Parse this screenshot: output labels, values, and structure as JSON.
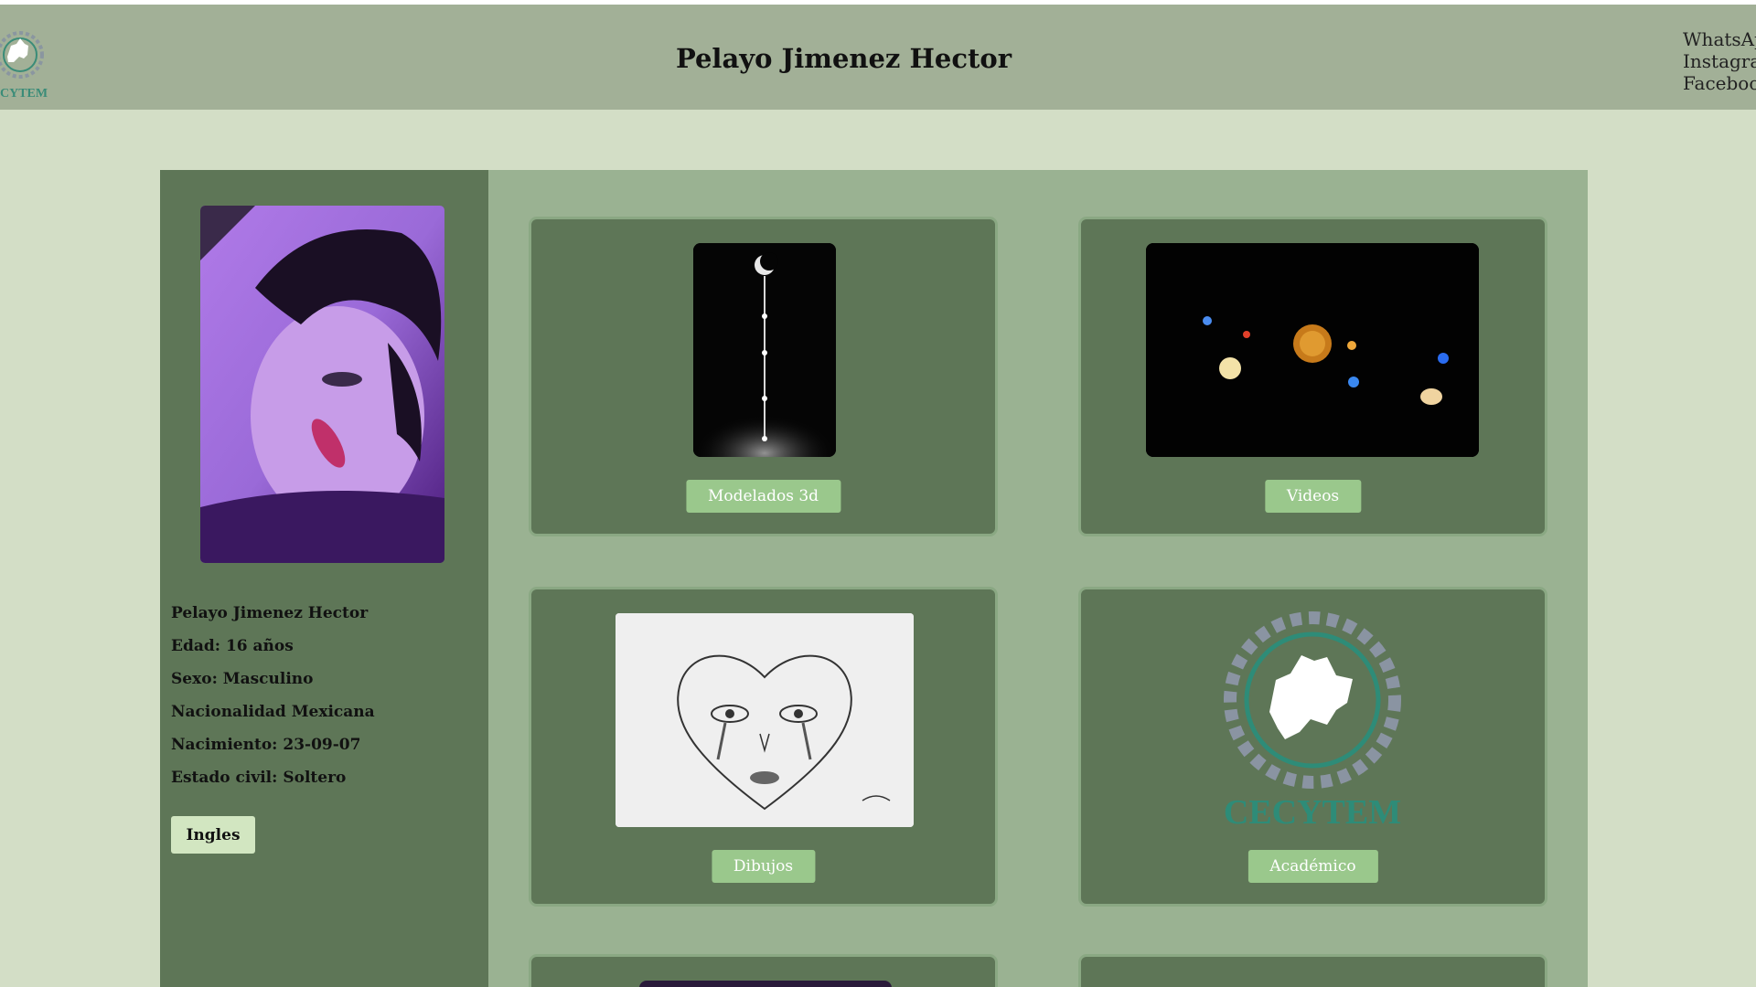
{
  "header": {
    "title": "Pelayo Jimenez Hector",
    "social_links": [
      "WhatsApp",
      "Instagram",
      "Facebook"
    ],
    "logo_icon": "cecytem-logo-icon"
  },
  "sidebar": {
    "info": [
      "Pelayo Jimenez Hector",
      "Edad: 16 años",
      "Sexo: Masculino",
      "Nacionalidad Mexicana",
      "Nacimiento: 23-09-07",
      "Estado civil: Soltero"
    ],
    "language_button": "Ingles"
  },
  "cards": [
    {
      "label": "Modelados 3d"
    },
    {
      "label": "Videos"
    },
    {
      "label": "Dibujos"
    },
    {
      "label": "Académico"
    }
  ],
  "logo_text": "CECYTEM",
  "colors": {
    "header_bg": "#a2b097",
    "page_bg": "#d3dec6",
    "panel_bg": "#9ab292",
    "card_bg": "#5e7657",
    "button_bg": "#9ac88c",
    "sidebar_button_bg": "#d2e6c1"
  }
}
